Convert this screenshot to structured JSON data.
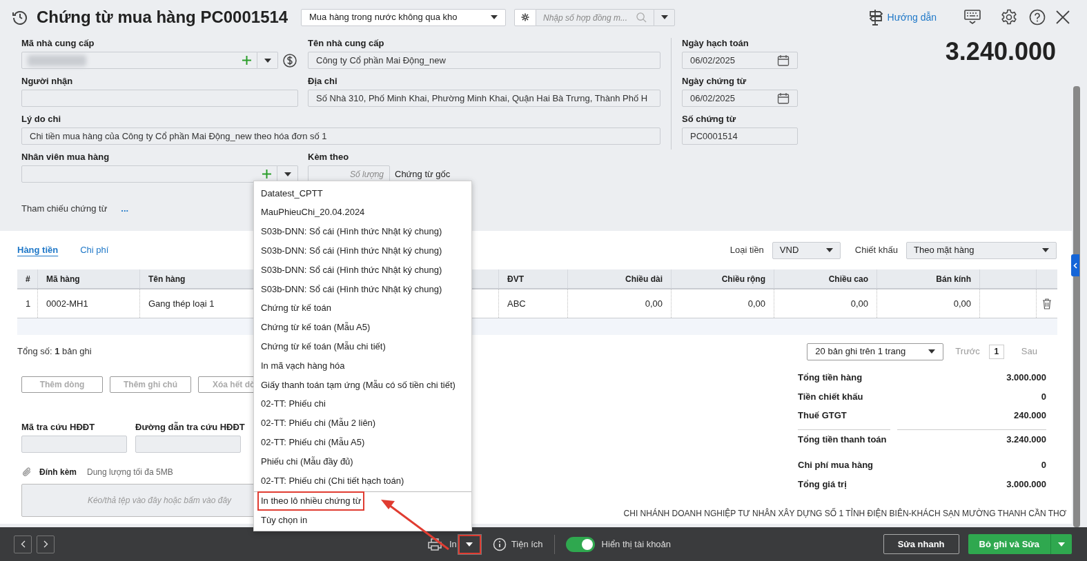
{
  "header": {
    "title": "Chứng từ mua hàng PC0001514",
    "voucher_type": "Mua hàng trong nước không qua kho",
    "contract_search": {
      "placeholder": "Nhập số hợp đồng m..."
    },
    "guide_link": "Hướng dẫn"
  },
  "form": {
    "supplier_code": {
      "label": "Mã nhà cung cấp"
    },
    "supplier_name": {
      "label": "Tên nhà cung cấp",
      "value": "Công ty Cổ phần Mai Động_new"
    },
    "recipient": {
      "label": "Người nhận"
    },
    "address": {
      "label": "Địa chỉ",
      "value": "Số Nhà 310, Phố Minh Khai, Phường Minh Khai, Quận Hai Bà Trưng, Thành Phố H"
    },
    "reason": {
      "label": "Lý do chi",
      "value": "Chi tiền mua hàng của Công ty Cổ phần Mai Động_new theo hóa đơn số 1"
    },
    "buyer": {
      "label": "Nhân viên mua hàng"
    },
    "attached": {
      "label": "Kèm theo",
      "placeholder": "Số lượng",
      "suffix": "Chứng từ gốc"
    },
    "reference": {
      "label": "Tham chiếu chứng từ",
      "link": "..."
    }
  },
  "side_fields": [
    {
      "label": "Ngày hạch toán",
      "value": "06/02/2025",
      "kind": "date"
    },
    {
      "label": "Ngày chứng từ",
      "value": "06/02/2025",
      "kind": "date"
    },
    {
      "label": "Số chứng từ",
      "value": "PC0001514",
      "kind": "text"
    }
  ],
  "total_amount": "3.240.000",
  "tabs": [
    {
      "label": "Hàng tiền",
      "selected": true
    },
    {
      "label": "Chi phí",
      "selected": false
    }
  ],
  "currency": {
    "label": "Loại tiền",
    "value": "VND"
  },
  "discount": {
    "label": "Chiết khấu",
    "value": "Theo mặt hàng"
  },
  "table": {
    "columns": [
      {
        "label": "#"
      },
      {
        "label": "Mã hàng"
      },
      {
        "label": "Tên hàng"
      },
      {
        "label": "ĐVT"
      },
      {
        "label": "Chiều dài"
      },
      {
        "label": "Chiều rộng"
      },
      {
        "label": "Chiều cao"
      },
      {
        "label": "Bán kính"
      }
    ],
    "rows": [
      {
        "cells": [
          "1",
          "0002-MH1",
          "Gang thép loại 1",
          "ABC",
          "0,00",
          "0,00",
          "0,00",
          "0,00"
        ]
      }
    ]
  },
  "record_count": "Tổng số: **1** bản ghi",
  "pagination": {
    "page_size": "20 bản ghi trên 1 trang",
    "prev": "Trước",
    "page": "1",
    "next": "Sau"
  },
  "row_buttons": [
    "Thêm dòng",
    "Thêm ghi chú",
    "Xóa hết dò"
  ],
  "einvoice": [
    {
      "label": "Mã tra cứu HĐĐT"
    },
    {
      "label": "Đường dẫn tra cứu HĐĐT"
    }
  ],
  "attachment": {
    "label": "Đính kèm",
    "hint": "Dung lượng tối đa 5MB",
    "dropzone": "Kéo/thả tệp vào đây hoặc bấm vào đây"
  },
  "totals": [
    {
      "label": "Tổng tiền hàng",
      "value": "3.000.000",
      "rule_before": false,
      "gap_before": false
    },
    {
      "label": "Tiền chiết khấu",
      "value": "0",
      "rule_before": false,
      "gap_before": false
    },
    {
      "label": "Thuế GTGT",
      "value": "240.000",
      "rule_before": false,
      "gap_before": false
    },
    {
      "label": "Tổng tiền thanh toán",
      "value": "3.240.000",
      "rule_before": true,
      "gap_before": false
    },
    {
      "label": "Chi phí mua hàng",
      "value": "0",
      "rule_before": false,
      "gap_before": true
    },
    {
      "label": "Tổng giá trị",
      "value": "3.000.000",
      "rule_before": false,
      "gap_before": false
    }
  ],
  "company": "CHI NHÁNH DOANH NGHIỆP TƯ NHÂN XÂY DỰNG SỐ 1 TỈNH ĐIỆN BIÊN-KHÁCH SẠN MƯỜNG THANH CẦN THƠ",
  "print_menu": {
    "items": [
      {
        "label": "Datatest_CPTT",
        "separator_before": false,
        "highlighted": false
      },
      {
        "label": "MauPhieuChi_20.04.2024",
        "separator_before": false,
        "highlighted": false
      },
      {
        "label": "S03b-DNN: Sổ cái (Hình thức Nhật ký chung)",
        "separator_before": false,
        "highlighted": false
      },
      {
        "label": "S03b-DNN: Sổ cái (Hình thức Nhật ký chung)",
        "separator_before": false,
        "highlighted": false
      },
      {
        "label": "S03b-DNN: Sổ cái (Hình thức Nhật ký chung)",
        "separator_before": false,
        "highlighted": false
      },
      {
        "label": "S03b-DNN: Sổ cái (Hình thức Nhật ký chung)",
        "separator_before": false,
        "highlighted": false
      },
      {
        "label": "Chứng từ kế toán",
        "separator_before": false,
        "highlighted": false
      },
      {
        "label": "Chứng từ kế toán (Mẫu A5)",
        "separator_before": false,
        "highlighted": false
      },
      {
        "label": "Chứng từ kế toán (Mẫu chi tiết)",
        "separator_before": false,
        "highlighted": false
      },
      {
        "label": "In mã vạch hàng hóa",
        "separator_before": false,
        "highlighted": false
      },
      {
        "label": "Giấy thanh toán tạm ứng (Mẫu có số tiền chi tiết)",
        "separator_before": false,
        "highlighted": false
      },
      {
        "label": "02-TT: Phiếu chi",
        "separator_before": false,
        "highlighted": false
      },
      {
        "label": "02-TT: Phiếu chi (Mẫu 2 liên)",
        "separator_before": false,
        "highlighted": false
      },
      {
        "label": "02-TT: Phiếu chi (Mẫu A5)",
        "separator_before": false,
        "highlighted": false
      },
      {
        "label": "Phiếu chi (Mẫu đầy đủ)",
        "separator_before": false,
        "highlighted": false
      },
      {
        "label": "02-TT: Phiếu chi (Chi tiết hạch toán)",
        "separator_before": false,
        "highlighted": false
      },
      {
        "label": "In theo lô nhiều chứng từ",
        "separator_before": true,
        "highlighted": true
      },
      {
        "label": "Tùy chọn in",
        "separator_before": false,
        "highlighted": false
      }
    ]
  },
  "footer": {
    "print": "In",
    "utilities": "Tiện ích",
    "toggle": {
      "label": "Hiển thị tài khoản",
      "on": true
    },
    "quick_edit": "Sửa nhanh",
    "primary": "Bỏ ghi và Sửa"
  }
}
